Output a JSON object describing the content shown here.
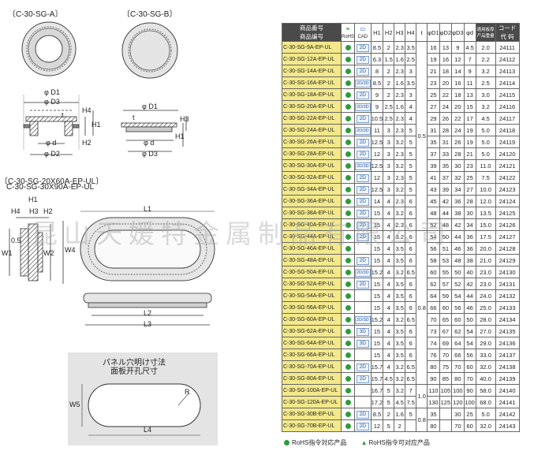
{
  "figures": {
    "title_a": "〔C-30-SG-A〕",
    "title_b": "〔C-30-SG-B〕",
    "title_ep_line1": "〔C-30-SG-20X60A-EP-UL〕",
    "title_ep_line2": "C-30-SG-30X90A-EP-UL",
    "panel_jp": "パネル穴明け寸法",
    "panel_cn": "面板开孔尺寸",
    "dims": {
      "d1": "φ D1",
      "d3": "φ D3",
      "d": "φ d",
      "d2": "φ D2",
      "t": "t",
      "h1": "H1",
      "h2": "H2",
      "h3": "H3",
      "h4": "H4",
      "l1": "L1",
      "l2": "L2",
      "l3": "L3",
      "l4": "L4",
      "w1": "W1",
      "w2": "W2",
      "w4": "W4",
      "w5": "W5",
      "r": "R",
      "c05": "0.5"
    }
  },
  "table": {
    "headers": {
      "part_jp": "商品番号",
      "part_cn": "商品编号",
      "rohs": "RoHS",
      "cad": "CAD",
      "h1": "H1",
      "h2": "H2",
      "h3": "H3",
      "h4": "H4",
      "t": "t",
      "d1": "φD1",
      "d2": "φD2",
      "d3": "φD3",
      "d": "φd",
      "panel_jp": "適用板厚",
      "panel_cn": "产品重量",
      "code_jp": "コード",
      "code_cn": "代 码"
    },
    "rows": [
      {
        "pn": "C-30-SG-9A-EP-UL",
        "cad": "2D",
        "h1": "8.5",
        "h2": "2",
        "h3": "2.3",
        "h4": "3.5",
        "d1": "16",
        "d2": "13",
        "d3": "9",
        "d": "4.5",
        "w": "2.0",
        "code": "24111"
      },
      {
        "pn": "C-30-SG-12A-EP-UL",
        "cad": "2D",
        "h1": "6.3",
        "h2": "1.5",
        "h3": "1.6",
        "h4": "2.5",
        "d1": "19",
        "d2": "16",
        "d3": "12",
        "d": "7",
        "w": "2.2",
        "code": "24112"
      },
      {
        "pn": "C-30-SG-14A-EP-UL",
        "cad": "2D",
        "h1": "8",
        "h2": "2",
        "h3": "2.3",
        "h4": "3",
        "d1": "21",
        "d2": "18",
        "d3": "14",
        "d": "9",
        "w": "3.2",
        "code": "24113"
      },
      {
        "pn": "C-30-SG-16A-EP-UL",
        "cad": "2D/3D",
        "h1": "8.5",
        "h2": "2",
        "h3": "1.6",
        "h4": "3.5",
        "d1": "23",
        "d2": "20",
        "d3": "16",
        "d": "11",
        "w": "2.5",
        "code": "24114"
      },
      {
        "pn": "C-30-SG-18A-EP-UL",
        "cad": "2D",
        "h1": "9",
        "h2": "2",
        "h3": "2.3",
        "h4": "3",
        "d1": "25",
        "d2": "22",
        "d3": "18",
        "d": "13",
        "w": "3.0",
        "code": "24115"
      },
      {
        "pn": "C-30-SG-20A-EP-UL",
        "cad": "2D/3D",
        "h1": "9",
        "h2": "2.5",
        "h3": "1.6",
        "h4": "4",
        "d1": "27",
        "d2": "24",
        "d3": "20",
        "d": "15",
        "w": "3.2",
        "code": "24116"
      },
      {
        "pn": "C-30-SG-22A-EP-UL",
        "cad": "2D",
        "h1": "10.5",
        "h2": "2.5",
        "h3": "2.3",
        "h4": "4",
        "d1": "29",
        "d2": "26",
        "d3": "22",
        "d": "17",
        "w": "4.5",
        "code": "24117"
      },
      {
        "pn": "C-30-SG-24A-EP-UL",
        "cad": "2D/3D",
        "h1": "11",
        "h2": "3",
        "h3": "2.3",
        "h4": "5",
        "d1": "31",
        "d2": "28",
        "d3": "24",
        "d": "19",
        "w": "5.0",
        "code": "24118"
      },
      {
        "pn": "C-30-SG-26A-EP-UL",
        "cad": "2D",
        "h1": "12.5",
        "h2": "3",
        "h3": "3.2",
        "h4": "5",
        "d1": "35",
        "d2": "31",
        "d3": "26",
        "d": "19",
        "w": "5.0",
        "code": "24119"
      },
      {
        "pn": "C-30-SG-28A-EP-UL",
        "cad": "2D",
        "h1": "12",
        "h2": "3",
        "h3": "2.3",
        "h4": "5",
        "d1": "37",
        "d2": "33",
        "d3": "28",
        "d": "21",
        "w": "5.0",
        "code": "24120"
      },
      {
        "pn": "C-30-SG-30A-EP-UL",
        "cad": "2D/3D",
        "h1": "12.5",
        "h2": "3",
        "h3": "3.2",
        "h4": "5",
        "d1": "39",
        "d2": "35",
        "d3": "30",
        "d": "23",
        "w": "11.0",
        "code": "24121"
      },
      {
        "pn": "C-30-SG-32A-EP-UL",
        "cad": "2D",
        "h1": "12",
        "h2": "3",
        "h3": "2.3",
        "h4": "5",
        "d1": "41",
        "d2": "37",
        "d3": "32",
        "d": "25",
        "w": "7.5",
        "code": "24122"
      },
      {
        "pn": "C-30-SG-34A-EP-UL",
        "cad": "2D",
        "h1": "12.5",
        "h2": "3",
        "h3": "3.2",
        "h4": "5",
        "d1": "43",
        "d2": "39",
        "d3": "34",
        "d": "27",
        "w": "10.0",
        "code": "24123"
      },
      {
        "pn": "C-30-SG-36A-EP-UL",
        "cad": "2D",
        "h1": "14",
        "h2": "4",
        "h3": "2.3",
        "h4": "6",
        "d1": "45",
        "d2": "42",
        "d3": "36",
        "d": "28",
        "w": "12.0",
        "code": "24124"
      },
      {
        "pn": "C-30-SG-38A-EP-UL",
        "cad": "2D",
        "h1": "15",
        "h2": "4",
        "h3": "3.2",
        "h4": "6",
        "d1": "48",
        "d2": "44",
        "d3": "38",
        "d": "30",
        "w": "13.5",
        "code": "24125"
      },
      {
        "pn": "C-30-SG-40A-EP-UL",
        "cad": "2D",
        "h1": "15",
        "h2": "4",
        "h3": "2.3",
        "h4": "6",
        "d1": "52",
        "d2": "48",
        "d3": "42",
        "d": "34",
        "w": "15.0",
        "code": "24126"
      },
      {
        "pn": "C-30-SG-44A-EP-UL",
        "cad": "2D",
        "h1": "15",
        "h2": "4",
        "h3": "3.2",
        "h4": "6",
        "d1": "54",
        "d2": "50",
        "d3": "44",
        "d": "36",
        "w": "17.5",
        "code": "24127"
      },
      {
        "pn": "C-30-SG-46A-EP-UL",
        "cad": "",
        "h1": "15",
        "h2": "4",
        "h3": "3.5",
        "h4": "6",
        "d1": "56",
        "d2": "51",
        "d3": "46",
        "d": "36",
        "w": "20.0",
        "code": "24128"
      },
      {
        "pn": "C-30-SG-48A-EP-UL",
        "cad": "2D",
        "h1": "15",
        "h2": "4",
        "h3": "3.5",
        "h4": "6",
        "d1": "58",
        "d2": "53",
        "d3": "48",
        "d": "38",
        "w": "21.0",
        "code": "24129"
      },
      {
        "pn": "C-30-SG-50A-EP-UL",
        "cad": "2D/3D",
        "h1": "15.2",
        "h2": "4",
        "h3": "3.2",
        "h4": "6.5",
        "d1": "60",
        "d2": "55",
        "d3": "50",
        "d": "40",
        "w": "23.0",
        "code": "24130"
      },
      {
        "pn": "C-30-SG-52A-EP-UL",
        "cad": "2D",
        "h1": "15",
        "h2": "4",
        "h3": "3.5",
        "h4": "6",
        "d1": "62",
        "d2": "57",
        "d3": "52",
        "d": "42",
        "w": "23.0",
        "code": "24131"
      },
      {
        "pn": "C-30-SG-54A-EP-UL",
        "cad": "",
        "h1": "15",
        "h2": "4",
        "h3": "3.5",
        "h4": "6",
        "d1": "64",
        "d2": "59",
        "d3": "54",
        "d": "44",
        "w": "24.0",
        "code": "24132"
      },
      {
        "pn": "C-30-SG-56A-EP-UL",
        "cad": "",
        "h1": "15",
        "h2": "4",
        "h3": "3.5",
        "h4": "6",
        "d1": "66",
        "d2": "60",
        "d3": "56",
        "d": "46",
        "w": "25.0",
        "code": "24133"
      },
      {
        "pn": "C-30-SG-60A-EP-UL",
        "cad": "2D/3D",
        "h1": "15.2",
        "h2": "4",
        "h3": "3.2",
        "h4": "6.5",
        "d1": "70",
        "d2": "65",
        "d3": "60",
        "d": "50",
        "w": "28.0",
        "code": "24134"
      },
      {
        "pn": "C-30-SG-62A-EP-UL",
        "cad": "3D",
        "h1": "15",
        "h2": "4",
        "h3": "3.5",
        "h4": "6",
        "d1": "73",
        "d2": "67",
        "d3": "62",
        "d": "54",
        "w": "27.0",
        "code": "24135"
      },
      {
        "pn": "C-30-SG-64A-EP-UL",
        "cad": "3D",
        "h1": "15",
        "h2": "4",
        "h3": "3.5",
        "h4": "6",
        "d1": "74",
        "d2": "69",
        "d3": "64",
        "d": "54",
        "w": "29.0",
        "code": "24136"
      },
      {
        "pn": "C-30-SG-66A-EP-UL",
        "cad": "",
        "h1": "15",
        "h2": "4",
        "h3": "3.5",
        "h4": "6",
        "d1": "76",
        "d2": "70",
        "d3": "66",
        "d": "56",
        "w": "33.0",
        "code": "24137"
      },
      {
        "pn": "C-30-SG-70A-EP-UL",
        "cad": "2D",
        "h1": "15.7",
        "h2": "4",
        "h3": "3.2",
        "h4": "6.5",
        "d1": "80",
        "d2": "75",
        "d3": "70",
        "d": "60",
        "w": "32.0",
        "code": "24138"
      },
      {
        "pn": "C-30-SG-80A-EP-UL",
        "cad": "2D",
        "h1": "15.7",
        "h2": "4.5",
        "h3": "3.2",
        "h4": "6.5",
        "d1": "90",
        "d2": "85",
        "d3": "80",
        "d": "70",
        "w": "40.0",
        "code": "24139"
      },
      {
        "pn": "C-30-SG-100A-EP-UL",
        "cad": "",
        "h1": "16.7",
        "h2": "5",
        "h3": "3.2",
        "h4": "7",
        "d1": "110",
        "d2": "105",
        "d3": "100",
        "d": "90",
        "w": "58.0",
        "code": "24140"
      },
      {
        "pn": "C-30-SG-120A-EP-UL",
        "cad": "",
        "h1": "17.2",
        "h2": "5",
        "h3": "4.5",
        "h4": "7.5",
        "d1": "130",
        "d2": "125",
        "d3": "120",
        "d": "100",
        "w": "68.0",
        "code": "24141"
      },
      {
        "pn": "C-30-SG-30B-EP-UL",
        "cad": "2D",
        "h1": "8.5",
        "h2": "2",
        "h3": "1.6",
        "h4": "5",
        "d1": "35",
        "d2": "",
        "d3": "30",
        "d": "25",
        "w": "5.0",
        "code": "24142"
      },
      {
        "pn": "C-30-SG-70B-EP-UL",
        "cad": "2D",
        "h1": "12",
        "h2": "5",
        "h3": "2",
        "h4": "",
        "d1": "80",
        "d2": "",
        "d3": "70",
        "d": "60",
        "w": "32.0",
        "code": "24143"
      }
    ],
    "t_values": [
      {
        "value": "0.5",
        "start": 0,
        "span": 16
      },
      {
        "value": "0.8",
        "start": 16,
        "span": 13
      },
      {
        "value": "1.0",
        "start": 29,
        "span": 2
      },
      {
        "value": "0.8",
        "start": 31,
        "span": 2
      }
    ]
  },
  "legend": {
    "rohs1": "RoHS指令対応产品",
    "rohs2": "RoHS指令可对应产品"
  },
  "watermark": "昆山天媛特金属制品有限公司"
}
